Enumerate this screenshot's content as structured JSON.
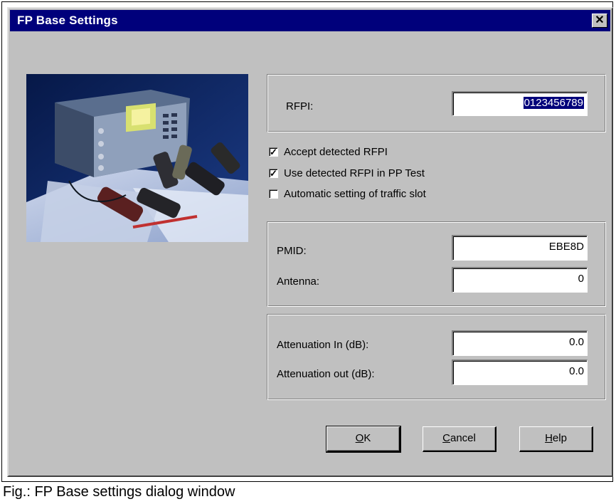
{
  "window": {
    "title": "FP Base Settings",
    "close_glyph": "✕"
  },
  "rfpi": {
    "label": "RFPI:",
    "value": "0123456789"
  },
  "checkboxes": [
    {
      "label": "Accept detected RFPI",
      "checked": true
    },
    {
      "label": "Use detected RFPI in PP Test",
      "checked": true
    },
    {
      "label": "Automatic setting of traffic slot",
      "checked": false
    }
  ],
  "pmid": {
    "label": "PMID:",
    "value": "EBE8D"
  },
  "antenna": {
    "label": "Antenna:",
    "value": "0"
  },
  "attenuation_in": {
    "label": "Attenuation In (dB):",
    "value": "0.0"
  },
  "attenuation_out": {
    "label": "Attenuation out (dB):",
    "value": "0.0"
  },
  "buttons": {
    "ok": {
      "mnemonic": "O",
      "rest": "K"
    },
    "cancel": {
      "mnemonic": "C",
      "rest": "ancel"
    },
    "help": {
      "mnemonic": "H",
      "rest": "elp"
    }
  },
  "caption": "Fig.: FP Base settings dialog window",
  "colors": {
    "titlebar": "#00007b",
    "dialog": "#c0c0c0",
    "selection": "#00007b"
  }
}
